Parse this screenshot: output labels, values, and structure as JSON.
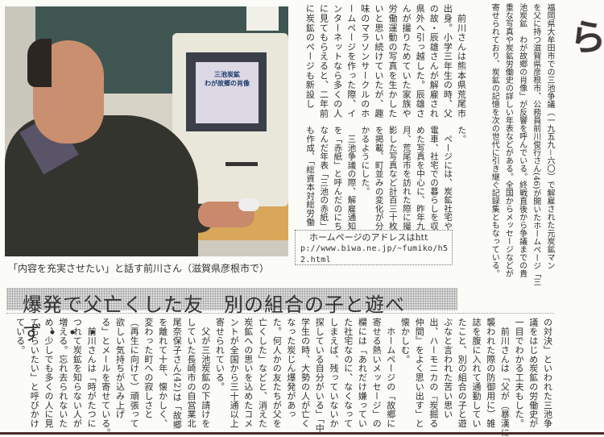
{
  "headline": "望郷メール全国から",
  "lead": [
    "福岡県大牟田市での三池争議（一九五九－六〇）で解雇された元炭鉱マン",
    "を父に持つ滋賀県彦根市、公務員前川俊行さん(46)が開いたホームページ「三",
    "池炭鉱　わが故郷の肖像」が反響を呼んでいる。終戦直後から争議までの貴",
    "重な写真や炭鉱労働史の詳しい年表などがある。全国からメッセージなどが",
    "寄せられており、炭鉱の記憶を次の世代に引き継ぐ記録集ともなっている。"
  ],
  "body_upper": [
    "　前川さんは熊本県荒尾市",
    "出身。小学三年生の時、父",
    "の故・辰雄さんが解雇され",
    "県外へ引っ越した。辰雄さ",
    "んが撮りためていた家族や",
    "労働運動の写真を生かした",
    "いと思い続けていたが、趣",
    "味のマラソンサークルのホ",
    "ームページを作った際、イ",
    "ンターネットなら多くの人",
    "に見てもらえると、二年前",
    "に炭鉱のページも新設し"
  ],
  "body_lower": [
    "た。",
    "　ページには、炭鉱社宅や",
    "電車、社宅での暮らしを収",
    "めた写真を中心に、昨年九",
    "月、荒尾市を訪れた際に撮",
    "影した写真など計百三十枚",
    "を掲載、町並みの変化が分",
    "かるようにした。",
    "　三池争議の際、解雇通知",
    "を「赤紙」と呼んだのにち",
    "なんだ年表「三池の赤紙」",
    "も作成、「総資本対総労働"
  ],
  "body_bottom": [
    "の対決」といわれた三池争",
    "議をはじめ炭鉱の労働史が",
    "一目でわかる工夫もした。",
    "　前川さんは「父が（暴漢に",
    "襲われた際の防御用に）雑",
    "誌を腹に入れて通勤してい",
    "たこと、別の組合の子と遊",
    "ぶなと言われた苦い思い",
    "出、ハーモニカの『炭掘る",
    "仲間』をよく思い出す」と",
    "懐かしむ。",
    "　ホームページの「故郷に",
    "寄せる熱いメッセージ」の",
    "欄には「あれだけ嫌ってい",
    "た社宅なのに、なくなって",
    "しまえば、残っていないか",
    "探している自分がいる」「中",
    "学生の時、大勢の人が亡く",
    "なった炭じん爆発があっ",
    "た。何人かの友たちが父を",
    "亡くした」などと、消えた",
    "炭鉱への思いを込めたコメ",
    "ントが全国から三十通以上",
    "寄せられている。",
    "　父が三池炭鉱の下請けを",
    "していた長崎市の自営業北",
    "尾奈保子さん(42)は「故郷",
    "を離れて十年、懐かしく、",
    "変わった町への寂しさと",
    "（再生に向けて）頑張って",
    "欲しい気持ちが込み上げ",
    "る」とメールを寄せている。",
    "　前川さんは「時がたつに",
    "つれて炭鉱を知らない人が",
    "増える。忘れ去られないた",
    "め、少しでも多くの人に見",
    "てもらいたい」と呼びかけ",
    "ている。"
  ],
  "photo": {
    "screen_line_1": "三池炭鉱",
    "screen_line_2": "わが故郷の肖像",
    "caption": "「内容を充実させたい」と話す前川さん（滋賀県彦根市で）"
  },
  "address_box": {
    "lines": [
      "　ホームページのアドレスはhtt",
      "p://www.biwa.ne.jp/~fumiko/h5",
      "2.html"
    ]
  },
  "subheadline": "爆発で父亡くした友　別の組合の子と遊べず・・・"
}
